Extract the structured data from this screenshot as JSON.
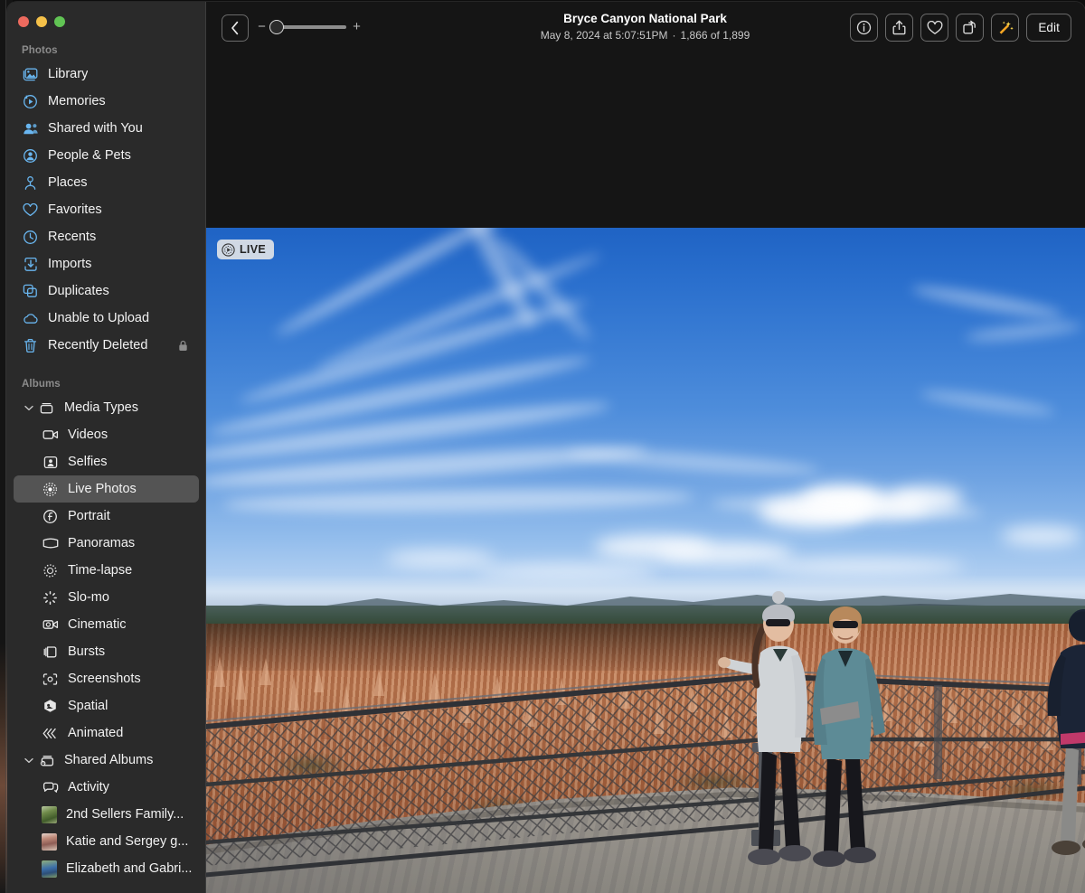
{
  "window": {
    "traffic_lights": [
      {
        "name": "close",
        "color": "#ED6A5E"
      },
      {
        "name": "minimize",
        "color": "#F5C149"
      },
      {
        "name": "zoom",
        "color": "#61C454"
      }
    ]
  },
  "sidebar": {
    "sections": [
      {
        "header": "Photos",
        "items": [
          {
            "label": "Library",
            "icon": "photo-library-icon",
            "selected": false
          },
          {
            "label": "Memories",
            "icon": "memories-icon",
            "selected": false
          },
          {
            "label": "Shared with You",
            "icon": "shared-with-you-icon",
            "selected": false
          },
          {
            "label": "People & Pets",
            "icon": "people-pets-icon",
            "selected": false
          },
          {
            "label": "Places",
            "icon": "places-pin-icon",
            "selected": false
          },
          {
            "label": "Favorites",
            "icon": "heart-icon",
            "selected": false
          },
          {
            "label": "Recents",
            "icon": "clock-icon",
            "selected": false
          },
          {
            "label": "Imports",
            "icon": "import-icon",
            "selected": false
          },
          {
            "label": "Duplicates",
            "icon": "duplicates-icon",
            "selected": false
          },
          {
            "label": "Unable to Upload",
            "icon": "cloud-icon",
            "selected": false
          },
          {
            "label": "Recently Deleted",
            "icon": "trash-icon",
            "selected": false,
            "trailing_icon": "lock-icon"
          }
        ]
      },
      {
        "header": "Albums",
        "groups": [
          {
            "label": "Media Types",
            "icon": "media-types-icon",
            "expanded": true,
            "items": [
              {
                "label": "Videos",
                "icon": "video-icon",
                "selected": false
              },
              {
                "label": "Selfies",
                "icon": "selfie-icon",
                "selected": false
              },
              {
                "label": "Live Photos",
                "icon": "live-photos-icon",
                "selected": true
              },
              {
                "label": "Portrait",
                "icon": "portrait-icon",
                "selected": false
              },
              {
                "label": "Panoramas",
                "icon": "panorama-icon",
                "selected": false
              },
              {
                "label": "Time-lapse",
                "icon": "timelapse-icon",
                "selected": false
              },
              {
                "label": "Slo-mo",
                "icon": "slomo-icon",
                "selected": false
              },
              {
                "label": "Cinematic",
                "icon": "cinematic-icon",
                "selected": false
              },
              {
                "label": "Bursts",
                "icon": "bursts-icon",
                "selected": false
              },
              {
                "label": "Screenshots",
                "icon": "screenshot-icon",
                "selected": false
              },
              {
                "label": "Spatial",
                "icon": "spatial-icon",
                "selected": false
              },
              {
                "label": "Animated",
                "icon": "animated-icon",
                "selected": false
              }
            ]
          },
          {
            "label": "Shared Albums",
            "icon": "shared-albums-icon",
            "expanded": true,
            "items": [
              {
                "label": "Activity",
                "icon": "activity-icon",
                "selected": false
              },
              {
                "label": "2nd Sellers Family...",
                "icon": "album-thumbnail",
                "thumb": "t1",
                "selected": false
              },
              {
                "label": "Katie and Sergey g...",
                "icon": "album-thumbnail",
                "thumb": "t2",
                "selected": false
              },
              {
                "label": "Elizabeth and Gabri...",
                "icon": "album-thumbnail",
                "thumb": "t3",
                "selected": false
              }
            ]
          }
        ]
      }
    ]
  },
  "toolbar": {
    "back_button": "back-chevron-icon",
    "zoom_slider": {
      "minus": "−",
      "plus": "+",
      "value": 0
    },
    "title": "Bryce Canyon National Park",
    "date": "May 8, 2024 at 5:07:51PM",
    "separator": "·",
    "index": "1,866 of 1,899",
    "buttons": [
      {
        "name": "info-button",
        "icon": "info-icon",
        "label": ""
      },
      {
        "name": "share-button",
        "icon": "share-icon",
        "label": ""
      },
      {
        "name": "favorite-button",
        "icon": "heart-icon",
        "label": ""
      },
      {
        "name": "rotate-button",
        "icon": "rotate-icon",
        "label": ""
      },
      {
        "name": "auto-enhance-button",
        "icon": "magic-wand-icon",
        "label": ""
      }
    ],
    "edit_label": "Edit"
  },
  "annotation": {
    "shape": "hand-drawn-ellipse",
    "color": "#b32a18",
    "target": "auto-enhance-button"
  },
  "photo": {
    "live_badge": {
      "label": "LIVE",
      "icon": "live-photo-icon"
    },
    "alt": "Two women posing at a Bryce Canyon overlook railing with three other visitors looking out over orange hoodoos under a blue sky"
  }
}
